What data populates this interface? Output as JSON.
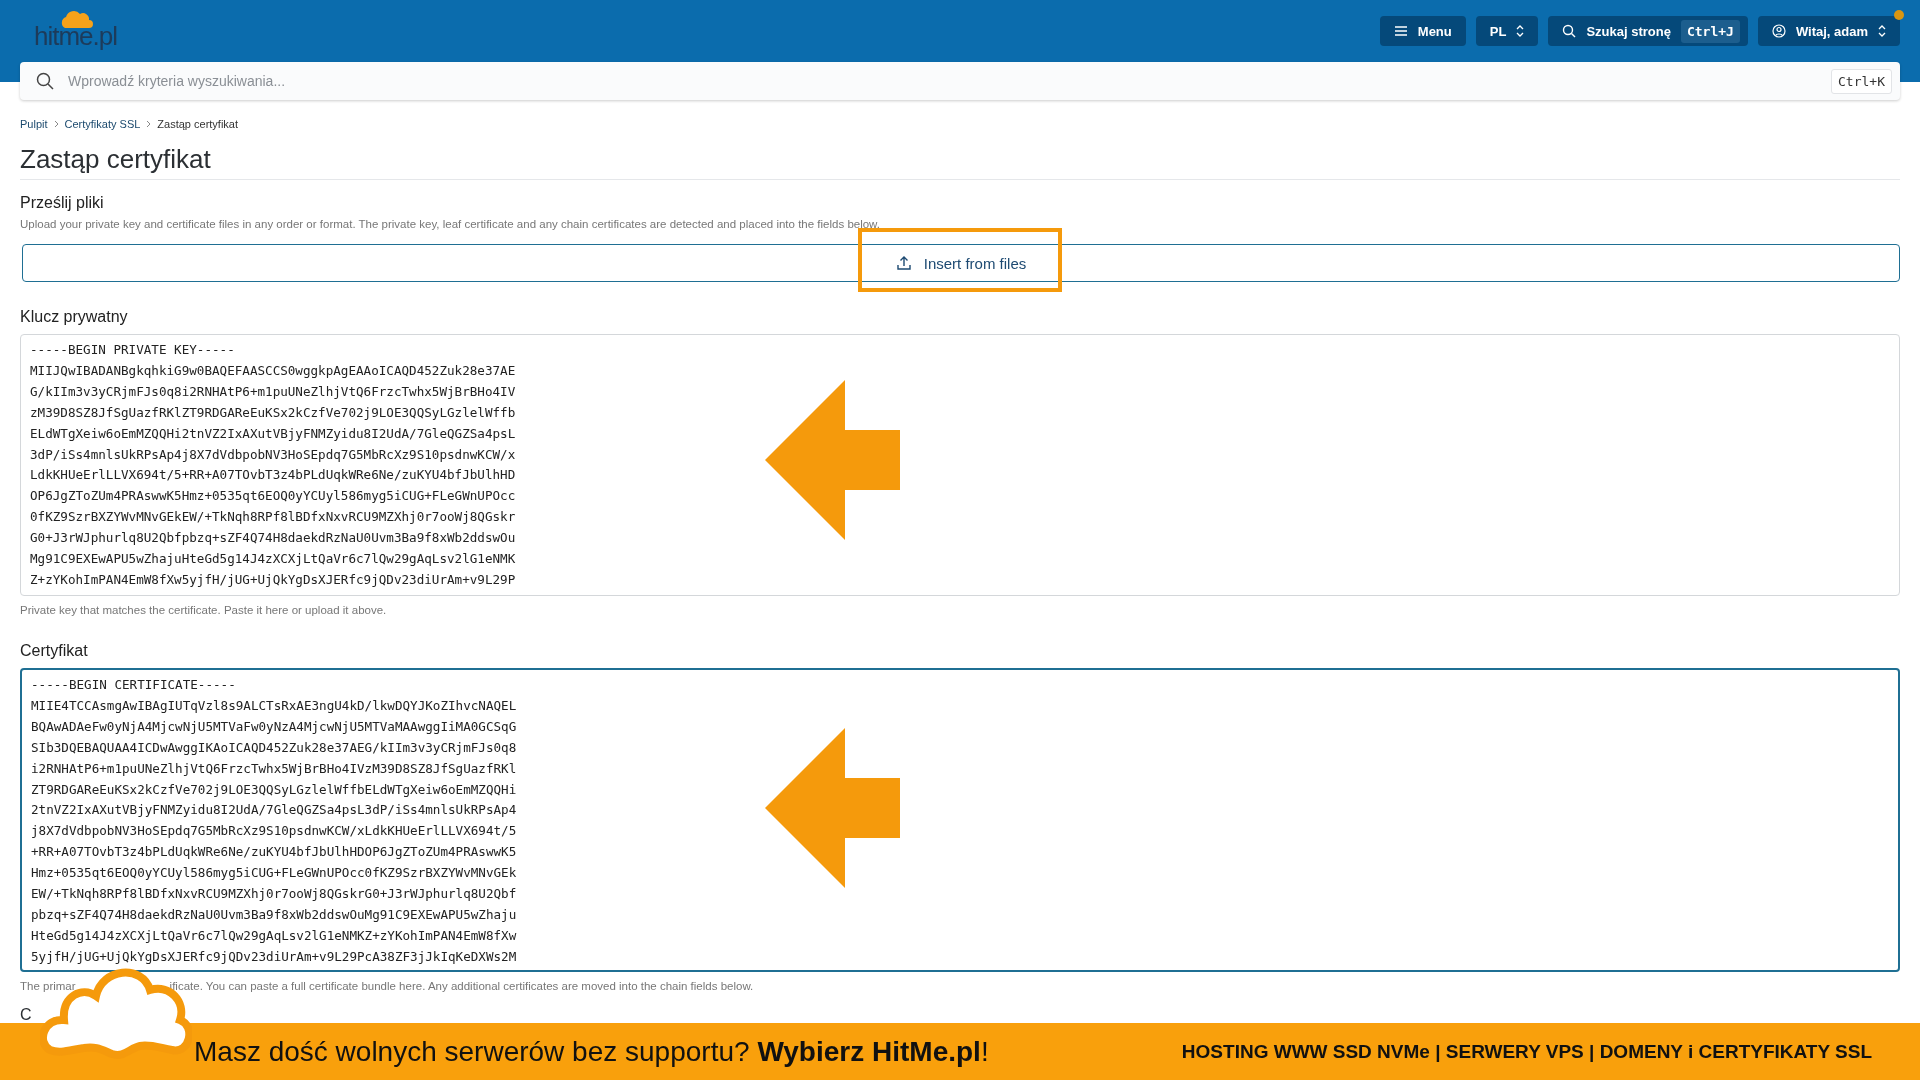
{
  "header": {
    "logo": "hitme.pl",
    "menu_button": "Menu",
    "language": "PL",
    "page_search": {
      "label": "Szukaj stronę",
      "shortcut": "Ctrl+J"
    },
    "user_menu": {
      "label": "Witaj, adam",
      "notification": true
    }
  },
  "search": {
    "placeholder": "Wprowadź kryteria wyszukiwania...",
    "shortcut": "Ctrl+K"
  },
  "breadcrumb": [
    {
      "label": "Pulpit",
      "kind": "link"
    },
    {
      "label": "Certyfikaty SSL",
      "kind": "link"
    },
    {
      "label": "Zastąp certyfikat",
      "kind": "current"
    }
  ],
  "title": "Zastąp certyfikat",
  "upload": {
    "heading": "Prześlij pliki",
    "description": "Upload your private key and certificate files in any order or format. The private key, leaf certificate and any chain certificates are detected and placed into the fields below.",
    "button": "Insert from files",
    "highlighted": true
  },
  "private_key": {
    "label": "Klucz prywatny",
    "focused": false,
    "pointer_arrow": true,
    "lines": [
      "-----BEGIN PRIVATE KEY-----",
      "MIIJQwIBADANBgkqhkiG9w0BAQEFAASCCS0wggkpAgEAAoICAQD452Zuk28e37AE",
      "G/kIIm3v3yCRjmFJs0q8i2RNHAtP6+m1puUNeZlhjVtQ6FrzcTwhx5WjBrBHo4IV",
      "zM39D8SZ8JfSgUazfRKlZT9RDGAReEuKSx2kCzfVe702j9LOE3QQSyLGzlelWffb",
      "ELdWTgXeiw6oEmMZQQHi2tnVZ2IxAXutVBjyFNMZyidu8I2UdA/7GleQGZSa4psL",
      "3dP/iSs4mnlsUkRPsAp4j8X7dVdbpobNV3HoSEpdq7G5MbRcXz9S10psdnwKCW/x",
      "LdkKHUeErlLLVX694t/5+RR+A07TOvbT3z4bPLdUqkWRe6Ne/zuKYU4bfJbUlhHD",
      "OP6JgZToZUm4PRAswwK5Hmz+0535qt6EOQ0yYCUyl586myg5iCUG+FLeGWnUPOcc",
      "0fKZ9SzrBXZYWvMNvGEkEW/+TkNqh8RPf8lBDfxNxvRCU9MZXhj0r7ooWj8QGskr",
      "G0+J3rWJphurlq8U2Qbfpbzq+sZF4Q74H8daekdRzNaU0Uvm3Ba9f8xWb2ddswOu",
      "Mg91C9EXEwAPU5wZhajuHteGd5g14J4zXCXjLtQaVr6c7lQw29gAqLsv2lG1eNMK",
      "Z+zYKohImPAN4EmW8fXw5yjfH/jUG+UjQkYgDsXJERfc9jQDv23diUrAm+v9L29P"
    ],
    "hint": "Private key that matches the certificate. Paste it here or upload it above."
  },
  "certificate": {
    "label": "Certyfikat",
    "focused": true,
    "pointer_arrow": true,
    "lines": [
      "-----BEGIN CERTIFICATE-----",
      "MIIE4TCCAsmgAwIBAgIUTqVzl8s9ALCTsRxAE3ngU4kD/lkwDQYJKoZIhvcNAQEL",
      "BQAwADAeFw0yNjA4MjcwNjU5MTVaFw0yNzA4MjcwNjU5MTVaMAAwggIiMA0GCSqG",
      "SIb3DQEBAQUAA4ICDwAwggIKAoICAQD452Zuk28e37AEG/kIIm3v3yCRjmFJs0q8",
      "i2RNHAtP6+m1puUNeZlhjVtQ6FrzcTwhx5WjBrBHo4IVzM39D8SZ8JfSgUazfRKl",
      "ZT9RDGAReEuKSx2kCzfVe702j9LOE3QQSyLGzlelWffbELdWTgXeiw6oEmMZQQHi",
      "2tnVZ2IxAXutVBjyFNMZyidu8I2UdA/7GleQGZSa4psL3dP/iSs4mnlsUkRPsAp4",
      "j8X7dVdbpobNV3HoSEpdq7G5MbRcXz9S10psdnwKCW/xLdkKHUeErlLLVX694t/5",
      "+RR+A07TOvbT3z4bPLdUqkWRe6Ne/zuKYU4bfJbUlhHDOP6JgZToZUm4PRAswwK5",
      "Hmz+0535qt6EOQ0yYCUyl586myg5iCUG+FLeGWnUPOcc0fKZ9SzrBXZYWvMNvGEk",
      "EW/+TkNqh8RPf8lBDfxNxvRCU9MZXhj0r7ooWj8QGskrG0+J3rWJphurlq8U2Qbf",
      "pbzq+sZF4Q74H8daekdRzNaU0Uvm3Ba9f8xWb2ddswOuMg91C9EXEwAPU5wZhaju",
      "HteGd5g14J4zXCXjLtQaVr6c7lQw29gAqLsv2lG1eNMKZ+zYKohImPAN4EmW8fXw",
      "5yjfH/jUG+UjQkYgDsXJERfc9jQDv23diUrAm+v9L29PcA38ZF3jJkIqKeDXWs2M"
    ],
    "hint_parts": [
      "The primar",
      "ificate. You can paste a full certificate bundle here. Any additional certificates are moved into the chain fields below."
    ]
  },
  "next_section": {
    "label": "C"
  },
  "banner": {
    "headline": "Masz dość wolnych serwerów bez supportu? **Wybierz HitMe.pl**!",
    "services": "HOSTING WWW SSD NVMe | SERWERY VPS | DOMENY i CERTYFIKATY SSL"
  }
}
